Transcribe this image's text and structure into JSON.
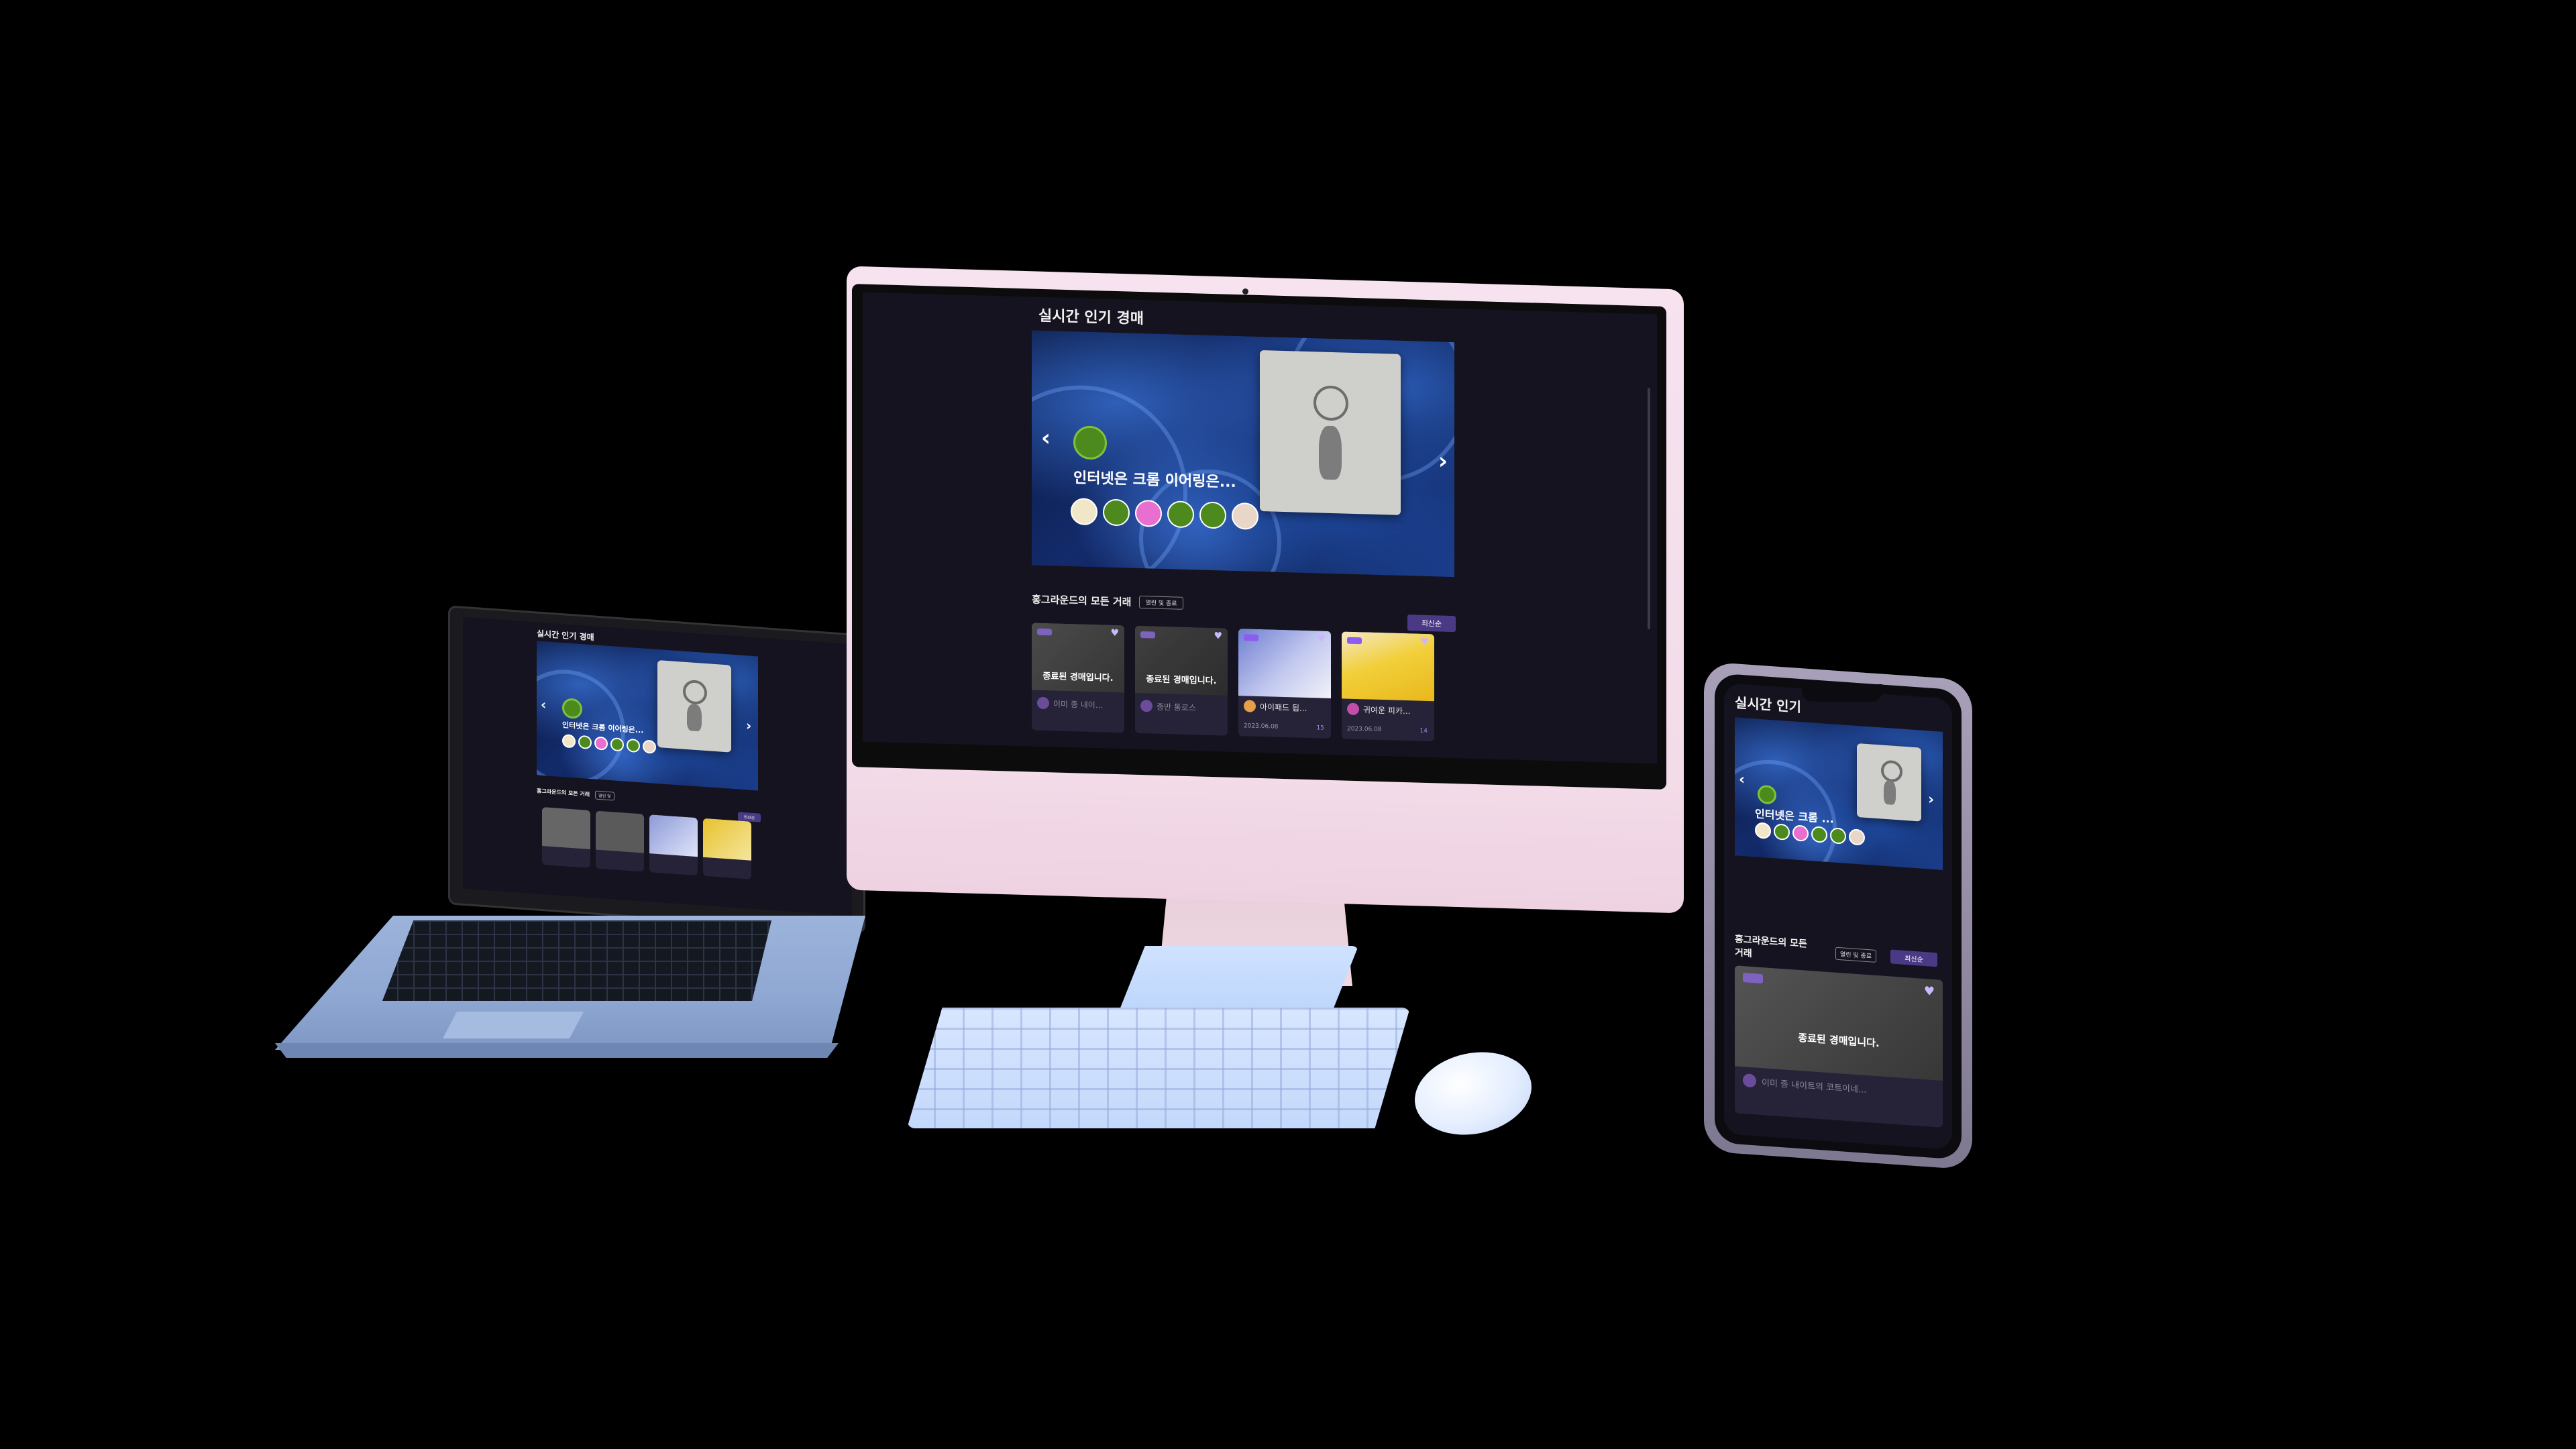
{
  "colors": {
    "background": "#000000",
    "app_bg": "#15131f",
    "card_bg": "#262238",
    "accent": "#4a3a86",
    "badge": "#8d5cf0",
    "imac_pink": "#f6e3ef",
    "accessory_blue": "#c3d8fb"
  },
  "imac": {
    "section_live": "실시간 인기 경매",
    "hero": {
      "title": "인터넷은 크롬 이어링은...",
      "prev_arrow": "‹",
      "next_arrow": "›",
      "bidder_colors": [
        "#f2e6c8",
        "#4d8a1e",
        "#e86fd0",
        "#4d8a1e",
        "#4d8a1e",
        "#e8d6c8"
      ]
    },
    "section_all": "홍그라운드의 모든 거래",
    "filter_chip": "열린 및 종료",
    "sort_button": "최신순",
    "cards": [
      {
        "ended_text": "종료된 경매입니다.",
        "name": "이미 종 내이...",
        "date": "",
        "count": ""
      },
      {
        "ended_text": "종료된 경매입니다.",
        "name": "종만 통로스",
        "date": "",
        "count": ""
      },
      {
        "name": "아이패드 됩...",
        "date": "2023.06.08",
        "count": "15"
      },
      {
        "name": "귀여운 피카...",
        "date": "2023.06.08",
        "count": "14"
      }
    ]
  },
  "laptop": {
    "section_live": "실시간 인기 경매",
    "hero_title": "인터넷은 크롬 이어링은...",
    "section_all": "홍그라운드의 모든 거래",
    "filter_chip": "열린 및",
    "sort_button": "최신순"
  },
  "phone": {
    "section_live": "실시간 인기",
    "hero_title": "인터넷은 크롬 ...",
    "section_all_line1": "홍그라운드의 모든",
    "section_all_line2": "거래",
    "filter_chip": "열린 및 종료",
    "sort_button": "최신순",
    "card": {
      "ended_text": "종료된 경매입니다.",
      "name": "이미 종 내이트의 코트이네..."
    }
  }
}
